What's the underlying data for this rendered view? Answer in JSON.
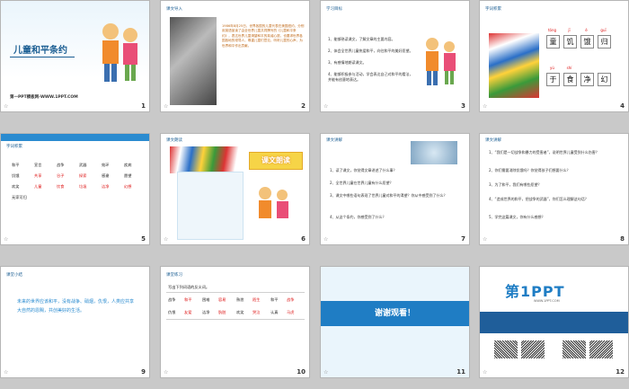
{
  "slides": [
    {
      "n": "1",
      "title": "儿童和平条约",
      "footer": "第一PPT模板网-WWW.1PPT.COM"
    },
    {
      "n": "2",
      "label": "课文导入",
      "text": "1986年8月25日，世界各国的儿童代表在美国纽约，分别用英语宣读了由全世界儿童共同撰写的《儿童和平条约》，表达世界儿童渴望和平的真诚心愿，也要求世界各国各地的领导人，尊重儿童们意见，听听儿童的心声，为世界和平作出贡献。"
    },
    {
      "n": "3",
      "label": "学习目标",
      "items": [
        "1、能够熟读课文，了解文章的主要内容。",
        "2、体会全世界儿童热爱和平，向往和平的美好愿望。",
        "3、有感情地朗读课文。",
        "4、能够积极参与活动，学会表达自己对和平的看法，并能有创意地表达。"
      ]
    },
    {
      "n": "4",
      "label": "字词积累",
      "py": [
        "tóng",
        "jī",
        "è",
        "guī",
        "yú",
        "shí"
      ],
      "chars": [
        "童",
        "饥",
        "饿",
        "归",
        "于",
        "食",
        "净",
        "幻"
      ]
    },
    {
      "n": "5",
      "label": "字词积累",
      "rows": [
        [
          "和平",
          "宣言",
          "战争",
          "武器",
          "效环",
          "疾病"
        ],
        [
          "饥饿",
          "共享",
          "谷子",
          "探索",
          "感谢",
          "愿望"
        ],
        [
          "欢笑",
          "儿童",
          "饮食",
          "垃圾",
          "洁净",
          "幻想"
        ],
        [
          "无家可归"
        ]
      ]
    },
    {
      "n": "6",
      "label": "课文朗读",
      "banner": "课文朗读"
    },
    {
      "n": "7",
      "label": "课文讲解",
      "items": [
        "1、读了课文，你觉得文章讲述了什么事？",
        "2、全世界儿童在世界儿童有什么愿望？",
        "3、课文中哪些语句表现了世界儿童对和平的渴望？你从中感受到了什么？",
        "4、从这个条约，你感受到了什么？"
      ]
    },
    {
      "n": "8",
      "label": "课文讲解",
      "items": [
        "1、“我们是一切战争和暴力的受害者”，说明世界儿童受到什么伤害？",
        "2、你们需要消除饥饿吗？你觉得孩子们想要什么？",
        "3、为了和平，我们有哪些愿望？",
        "4、“造成世界的和平，把战争的武器”，你们怎么理解这句话？",
        "5、学完这篇课文，你有什么感想？"
      ]
    },
    {
      "n": "9",
      "label": "课堂小结",
      "text": "未来的世界应该和平，没有战争、硝烟，仇恨，人类应共享大自然的恩赐，共创美好的生活。"
    },
    {
      "n": "10",
      "label": "课堂练习",
      "prompt": "写出下列词语的反义词。",
      "pairs": [
        [
          "战争",
          "和平"
        ],
        [
          "困难",
          "容易"
        ],
        [
          "熟悉",
          "陌生"
        ],
        [
          "和平",
          "战争"
        ],
        [
          "仇恨",
          "友爱"
        ],
        [
          "洁净",
          "肮脏"
        ],
        [
          "欢笑",
          "哭泣"
        ],
        [
          "认真",
          "马虎"
        ]
      ]
    },
    {
      "n": "11",
      "thanks": "谢谢观看！"
    },
    {
      "n": "12",
      "brand": "第1PPT",
      "site": "WWW.1PPT.COM"
    }
  ],
  "colors": {
    "accent": "#2a8bd0",
    "title": "#1b5e93",
    "answer": "#d11111"
  }
}
